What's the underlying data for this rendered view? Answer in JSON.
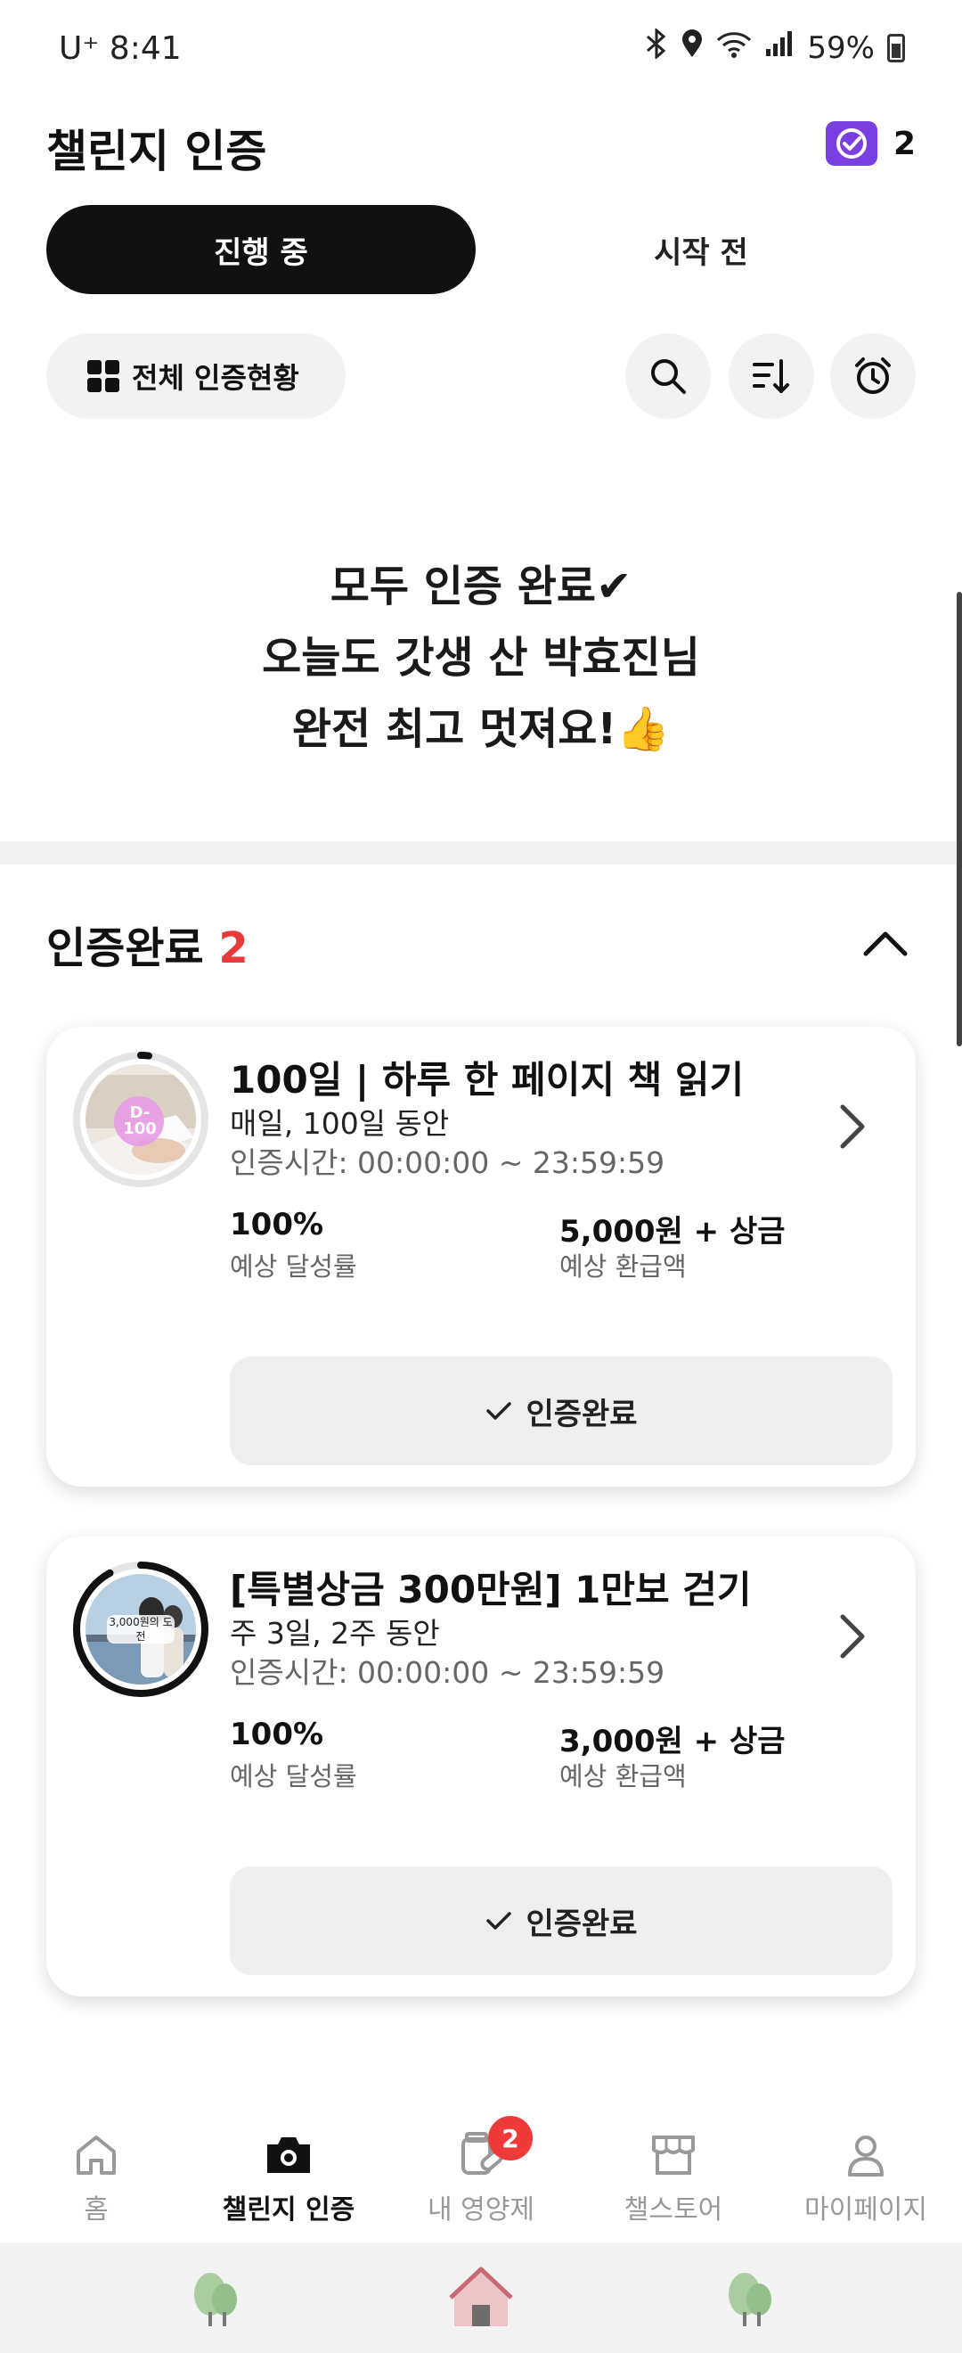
{
  "status_bar": {
    "carrier": "U⁺ 8:41",
    "battery": "59%"
  },
  "header": {
    "title": "챌린지 인증",
    "badge_count": "2"
  },
  "tabs": [
    {
      "label": "진행 중",
      "active": true
    },
    {
      "label": "시작 전",
      "active": false
    }
  ],
  "toolbar": {
    "overview_label": "전체 인증현황",
    "icons": [
      "search-icon",
      "sort-icon",
      "alarm-icon"
    ]
  },
  "message": {
    "line1": "모두 인증 완료✔",
    "line2": "오늘도 갓생 산 박효진님",
    "line3": "완전 최고 멋져요!👍"
  },
  "section": {
    "title": "인증완료",
    "count": "2"
  },
  "cards": [
    {
      "title": "100일 | 하루 한 페이지 책 읽기",
      "subtitle": "매일, 100일 동안",
      "time": "인증시간: 00:00:00 ~ 23:59:59",
      "rate_value": "100%",
      "rate_label": "예상 달성률",
      "refund_value": "5,000원 + 상금",
      "refund_label": "예상 환급액",
      "thumb_tag": "D-100",
      "done_label": "인증완료",
      "progress": 0.02
    },
    {
      "title": "[특별상금 300만원] 1만보 걷기",
      "subtitle": "주 3일, 2주 동안",
      "time": "인증시간: 00:00:00 ~ 23:59:59",
      "rate_value": "100%",
      "rate_label": "예상 달성률",
      "refund_value": "3,000원 + 상금",
      "refund_label": "예상 환급액",
      "thumb_tag": "3,000원의 도전",
      "done_label": "인증완료",
      "progress": 0.92
    }
  ],
  "bottom_nav": [
    {
      "label": "홈",
      "icon": "home-icon",
      "active": false
    },
    {
      "label": "챌린지 인증",
      "icon": "camera-icon",
      "active": true
    },
    {
      "label": "내 영양제",
      "icon": "supplement-icon",
      "active": false,
      "badge": "2"
    },
    {
      "label": "챌스토어",
      "icon": "store-icon",
      "active": false
    },
    {
      "label": "마이페이지",
      "icon": "person-icon",
      "active": false
    }
  ],
  "colors": {
    "accent_purple": "#7a3fe0",
    "badge_red": "#e8393b",
    "tab_active_bg": "#111111"
  }
}
